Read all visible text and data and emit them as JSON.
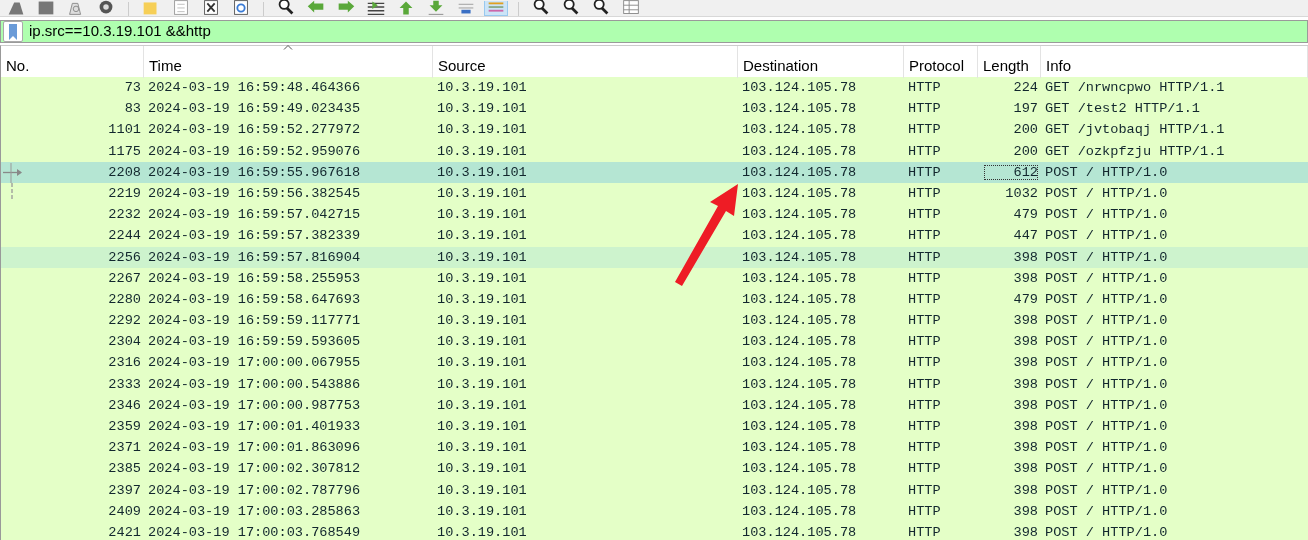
{
  "toolbar": {
    "buttons": [
      {
        "kind": "fin",
        "on": false
      },
      {
        "kind": "stop",
        "on": false
      },
      {
        "kind": "restart",
        "on": false
      },
      {
        "kind": "options",
        "on": false
      },
      {
        "kind": "sep"
      },
      {
        "kind": "open",
        "on": false
      },
      {
        "kind": "file",
        "on": false
      },
      {
        "kind": "close",
        "on": false
      },
      {
        "kind": "reload",
        "on": false
      },
      {
        "kind": "sep"
      },
      {
        "kind": "find",
        "on": false
      },
      {
        "kind": "back",
        "on": false
      },
      {
        "kind": "forward",
        "on": false
      },
      {
        "kind": "goto",
        "on": false
      },
      {
        "kind": "first",
        "on": false
      },
      {
        "kind": "last",
        "on": false
      },
      {
        "kind": "autoscroll",
        "on": false
      },
      {
        "kind": "colorize",
        "on": true
      },
      {
        "kind": "sep"
      },
      {
        "kind": "zoom",
        "on": false
      },
      {
        "kind": "zoom",
        "on": false
      },
      {
        "kind": "zoom",
        "on": false
      },
      {
        "kind": "resize",
        "on": false
      }
    ]
  },
  "filter": {
    "value": "ip.src==10.3.19.101 &&http"
  },
  "table": {
    "columns": [
      {
        "label": "No.",
        "sorted": false
      },
      {
        "label": "Time",
        "sorted": true
      },
      {
        "label": "Source",
        "sorted": false
      },
      {
        "label": "Destination",
        "sorted": false
      },
      {
        "label": "Protocol",
        "sorted": false
      },
      {
        "label": "Length",
        "sorted": false
      },
      {
        "label": "Info",
        "sorted": false
      }
    ],
    "rows": [
      {
        "no": "73",
        "time": "2024-03-19 16:59:48.464366",
        "source": "10.3.19.101",
        "destination": "103.124.105.78",
        "protocol": "HTTP",
        "length": "224",
        "info": "GET /nrwncpwo HTTP/1.1",
        "selected": false,
        "hovered": false
      },
      {
        "no": "83",
        "time": "2024-03-19 16:59:49.023435",
        "source": "10.3.19.101",
        "destination": "103.124.105.78",
        "protocol": "HTTP",
        "length": "197",
        "info": "GET /test2 HTTP/1.1",
        "selected": false,
        "hovered": false
      },
      {
        "no": "1101",
        "time": "2024-03-19 16:59:52.277972",
        "source": "10.3.19.101",
        "destination": "103.124.105.78",
        "protocol": "HTTP",
        "length": "200",
        "info": "GET /jvtobaqj HTTP/1.1",
        "selected": false,
        "hovered": false
      },
      {
        "no": "1175",
        "time": "2024-03-19 16:59:52.959076",
        "source": "10.3.19.101",
        "destination": "103.124.105.78",
        "protocol": "HTTP",
        "length": "200",
        "info": "GET /ozkpfzju HTTP/1.1",
        "selected": false,
        "hovered": false
      },
      {
        "no": "2208",
        "time": "2024-03-19 16:59:55.967618",
        "source": "10.3.19.101",
        "destination": "103.124.105.78",
        "protocol": "HTTP",
        "length": "612",
        "info": "POST / HTTP/1.0",
        "selected": true,
        "hovered": false,
        "focused": true,
        "related": true
      },
      {
        "no": "2219",
        "time": "2024-03-19 16:59:56.382545",
        "source": "10.3.19.101",
        "destination": "103.124.105.78",
        "protocol": "HTTP",
        "length": "1032",
        "info": "POST / HTTP/1.0",
        "selected": false,
        "hovered": false,
        "related": true
      },
      {
        "no": "2232",
        "time": "2024-03-19 16:59:57.042715",
        "source": "10.3.19.101",
        "destination": "103.124.105.78",
        "protocol": "HTTP",
        "length": "479",
        "info": "POST / HTTP/1.0",
        "selected": false,
        "hovered": false
      },
      {
        "no": "2244",
        "time": "2024-03-19 16:59:57.382339",
        "source": "10.3.19.101",
        "destination": "103.124.105.78",
        "protocol": "HTTP",
        "length": "447",
        "info": "POST / HTTP/1.0",
        "selected": false,
        "hovered": false
      },
      {
        "no": "2256",
        "time": "2024-03-19 16:59:57.816904",
        "source": "10.3.19.101",
        "destination": "103.124.105.78",
        "protocol": "HTTP",
        "length": "398",
        "info": "POST / HTTP/1.0",
        "selected": false,
        "hovered": true
      },
      {
        "no": "2267",
        "time": "2024-03-19 16:59:58.255953",
        "source": "10.3.19.101",
        "destination": "103.124.105.78",
        "protocol": "HTTP",
        "length": "398",
        "info": "POST / HTTP/1.0",
        "selected": false,
        "hovered": false
      },
      {
        "no": "2280",
        "time": "2024-03-19 16:59:58.647693",
        "source": "10.3.19.101",
        "destination": "103.124.105.78",
        "protocol": "HTTP",
        "length": "479",
        "info": "POST / HTTP/1.0",
        "selected": false,
        "hovered": false
      },
      {
        "no": "2292",
        "time": "2024-03-19 16:59:59.117771",
        "source": "10.3.19.101",
        "destination": "103.124.105.78",
        "protocol": "HTTP",
        "length": "398",
        "info": "POST / HTTP/1.0",
        "selected": false,
        "hovered": false
      },
      {
        "no": "2304",
        "time": "2024-03-19 16:59:59.593605",
        "source": "10.3.19.101",
        "destination": "103.124.105.78",
        "protocol": "HTTP",
        "length": "398",
        "info": "POST / HTTP/1.0",
        "selected": false,
        "hovered": false
      },
      {
        "no": "2316",
        "time": "2024-03-19 17:00:00.067955",
        "source": "10.3.19.101",
        "destination": "103.124.105.78",
        "protocol": "HTTP",
        "length": "398",
        "info": "POST / HTTP/1.0",
        "selected": false,
        "hovered": false
      },
      {
        "no": "2333",
        "time": "2024-03-19 17:00:00.543886",
        "source": "10.3.19.101",
        "destination": "103.124.105.78",
        "protocol": "HTTP",
        "length": "398",
        "info": "POST / HTTP/1.0",
        "selected": false,
        "hovered": false
      },
      {
        "no": "2346",
        "time": "2024-03-19 17:00:00.987753",
        "source": "10.3.19.101",
        "destination": "103.124.105.78",
        "protocol": "HTTP",
        "length": "398",
        "info": "POST / HTTP/1.0",
        "selected": false,
        "hovered": false
      },
      {
        "no": "2359",
        "time": "2024-03-19 17:00:01.401933",
        "source": "10.3.19.101",
        "destination": "103.124.105.78",
        "protocol": "HTTP",
        "length": "398",
        "info": "POST / HTTP/1.0",
        "selected": false,
        "hovered": false
      },
      {
        "no": "2371",
        "time": "2024-03-19 17:00:01.863096",
        "source": "10.3.19.101",
        "destination": "103.124.105.78",
        "protocol": "HTTP",
        "length": "398",
        "info": "POST / HTTP/1.0",
        "selected": false,
        "hovered": false
      },
      {
        "no": "2385",
        "time": "2024-03-19 17:00:02.307812",
        "source": "10.3.19.101",
        "destination": "103.124.105.78",
        "protocol": "HTTP",
        "length": "398",
        "info": "POST / HTTP/1.0",
        "selected": false,
        "hovered": false
      },
      {
        "no": "2397",
        "time": "2024-03-19 17:00:02.787796",
        "source": "10.3.19.101",
        "destination": "103.124.105.78",
        "protocol": "HTTP",
        "length": "398",
        "info": "POST / HTTP/1.0",
        "selected": false,
        "hovered": false
      },
      {
        "no": "2409",
        "time": "2024-03-19 17:00:03.285863",
        "source": "10.3.19.101",
        "destination": "103.124.105.78",
        "protocol": "HTTP",
        "length": "398",
        "info": "POST / HTTP/1.0",
        "selected": false,
        "hovered": false
      },
      {
        "no": "2421",
        "time": "2024-03-19 17:00:03.768549",
        "source": "10.3.19.101",
        "destination": "103.124.105.78",
        "protocol": "HTTP",
        "length": "398",
        "info": "POST / HTTP/1.0",
        "selected": false,
        "hovered": false
      }
    ]
  }
}
